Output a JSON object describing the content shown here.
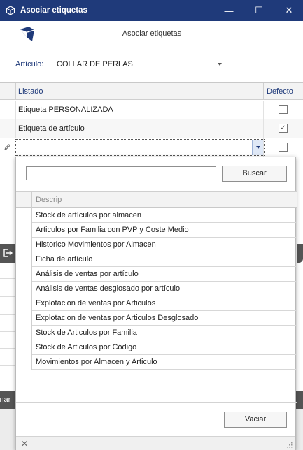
{
  "window": {
    "title": "Asociar etiquetas",
    "controls": {
      "minimize": "—",
      "maximize": "☐",
      "close": "✕"
    }
  },
  "header": {
    "subtitle": "Asociar etiquetas",
    "article_label": "Artículo:",
    "article_value": "COLLAR DE PERLAS"
  },
  "grid": {
    "columns": [
      "Listado",
      "Defecto"
    ],
    "rows": [
      {
        "listado": "Etiqueta PERSONALIZADA",
        "checked_mark": ""
      },
      {
        "listado": "Etiqueta de artículo",
        "checked_mark": "✓"
      }
    ]
  },
  "popup": {
    "search_value": "",
    "search_button": "Buscar",
    "list_header": "Descrip",
    "items": [
      "Stock de artículos por almacen",
      "Articulos por Familia con PVP y Coste Medio",
      "Historico Movimientos por Almacen",
      "Ficha de artículo",
      "Análisis de ventas por artículo",
      "Análisis de ventas desglosado por artículo",
      "Explotacion de ventas por Articulos",
      "Explotacion de ventas por Articulos Desglosado",
      "Stock de Articulos por Familia",
      "Stock de Articulos por Código",
      "Movimientos por Almacen y Articulo"
    ],
    "clear_button": "Vaciar",
    "status_close": "✕"
  },
  "background": {
    "finalizar_fragment": "inar"
  },
  "colors": {
    "titlebar": "#1f3a7a",
    "accent_text": "#1f3a7a"
  }
}
